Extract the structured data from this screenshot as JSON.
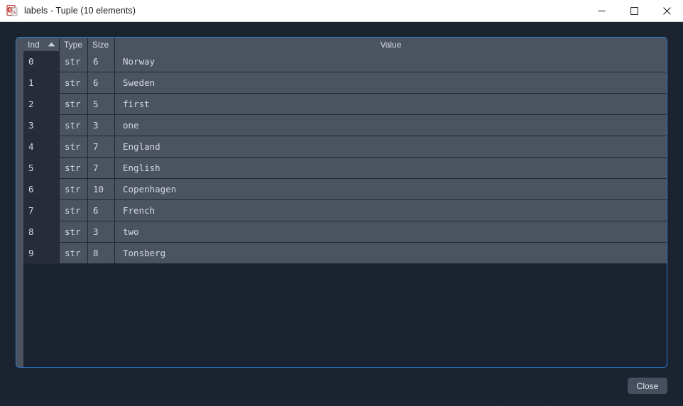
{
  "window": {
    "title": "labels - Tuple (10 elements)",
    "icon": "spyder-variable-explorer-icon",
    "controls": {
      "minimize": "minimize-icon",
      "maximize": "maximize-icon",
      "close": "close-icon"
    }
  },
  "table": {
    "sort_column": "Ind",
    "sort_direction": "ascending",
    "sort_indicator": "triangle-up-icon",
    "columns": [
      {
        "key": "index",
        "label": "Ind"
      },
      {
        "key": "type",
        "label": "Type"
      },
      {
        "key": "size",
        "label": "Size"
      },
      {
        "key": "value",
        "label": "Value"
      }
    ],
    "rows": [
      {
        "index": "0",
        "type": "str",
        "size": "6",
        "value": "Norway"
      },
      {
        "index": "1",
        "type": "str",
        "size": "6",
        "value": "Sweden"
      },
      {
        "index": "2",
        "type": "str",
        "size": "5",
        "value": "first"
      },
      {
        "index": "3",
        "type": "str",
        "size": "3",
        "value": "one"
      },
      {
        "index": "4",
        "type": "str",
        "size": "7",
        "value": "England"
      },
      {
        "index": "5",
        "type": "str",
        "size": "7",
        "value": "English"
      },
      {
        "index": "6",
        "type": "str",
        "size": "10",
        "value": "Copenhagen"
      },
      {
        "index": "7",
        "type": "str",
        "size": "6",
        "value": "French"
      },
      {
        "index": "8",
        "type": "str",
        "size": "3",
        "value": "two"
      },
      {
        "index": "9",
        "type": "str",
        "size": "8",
        "value": "Tonsberg"
      }
    ]
  },
  "footer": {
    "close_label": "Close"
  },
  "colors": {
    "titlebar_bg": "#ffffff",
    "titlebar_text": "#1b1b1b",
    "window_bg": "#1b2230",
    "focus_border": "#2f7fd4",
    "header_bg": "#4b5360",
    "row_bg": "#4b5360",
    "index_cell_bg": "#262c38",
    "text": "#d3d9e1",
    "button_bg": "#454f5e"
  }
}
